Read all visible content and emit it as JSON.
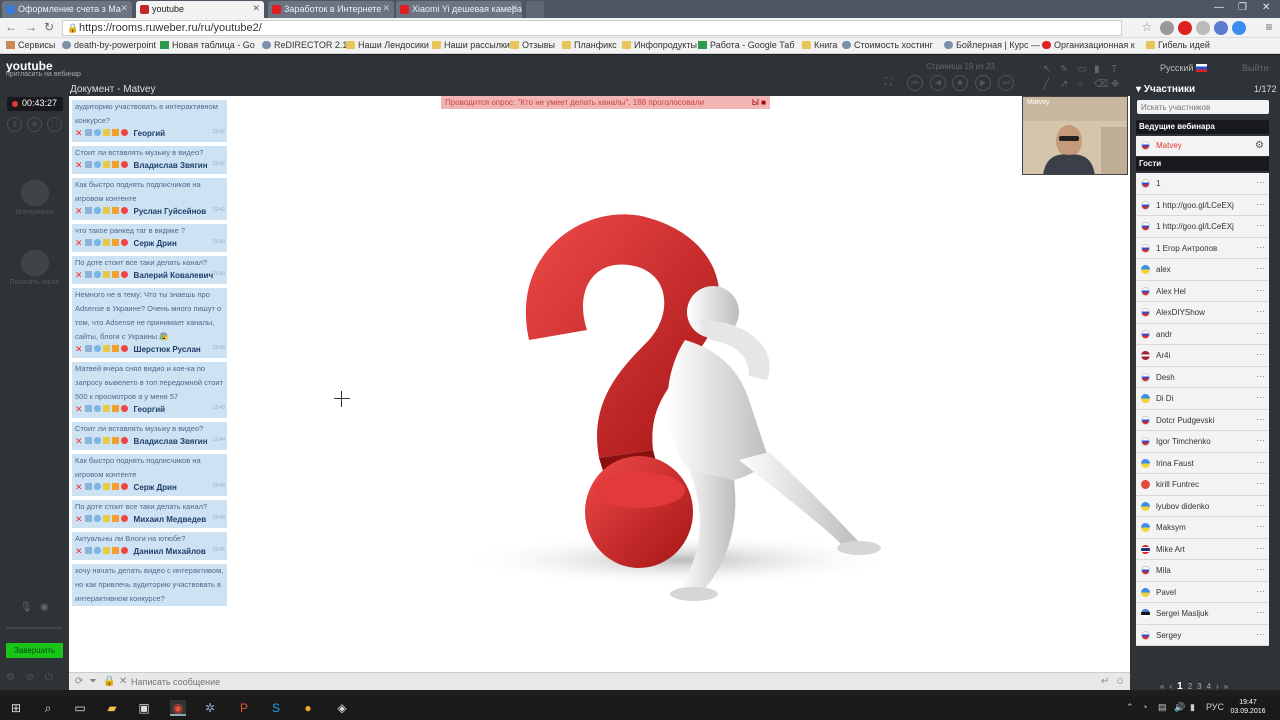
{
  "browser": {
    "tabs": [
      {
        "label": "Оформление счета з Ма",
        "active": false
      },
      {
        "label": "youtube",
        "active": true
      },
      {
        "label": "Заработок в Интернете",
        "active": false
      },
      {
        "label": "Xiaomi Yi дешевая камера",
        "active": false
      }
    ],
    "url": "https://rooms.ruweber.ru/ru/youtube2/",
    "bookmarks": [
      "Сервисы",
      "death-by-powerpoint",
      "Новая таблица - Go",
      "ReDIRECTOR 2.1.2",
      "Наши Лендосики",
      "Наши рассылки",
      "Отзывы",
      "Планфикс",
      "Инфопродукты",
      "Работа - Google Таб",
      "Книга",
      "Стоимость хостинг",
      "Бойлерная | Курс —",
      "Организационная к",
      "Гибель идей"
    ]
  },
  "app": {
    "title": "youtube",
    "subtitle": "пригласить на вебинар",
    "document_title": "Документ - Matvey",
    "page_indicator": "Страница 19 из 23",
    "language": "Русский",
    "exit_label": "Выйти",
    "timer": "00:43:27",
    "finish_label": "Завершить",
    "rail_items": [
      "Материалы",
      "Показать экран"
    ]
  },
  "poll_banner": {
    "text": "Проводится опрос: \"Кто не умеет делать каналы\", 188 проголосовали",
    "stop_label": "Ы ■"
  },
  "chat": {
    "placeholder": "Написать сообщение",
    "messages": [
      {
        "text": "аудиторию участвовать в интерактивном конкурсе?",
        "author": "Георгий",
        "time": "19:42"
      },
      {
        "text": "Стоит ли вставлять музыку в видео?",
        "author": "Владислав Звягин",
        "time": "19:42"
      },
      {
        "text": "Как быстро поднять подписчиков на игровом контенте",
        "author": "Руслан Гуйсейнов",
        "time": "19:42"
      },
      {
        "text": "что такое ранкед таг в видике ?",
        "author": "Серж Дрин",
        "time": "19:43"
      },
      {
        "text": "По доте стоит все таки делать канал?",
        "author": "Валерий Ковалевич",
        "time": "19:43"
      },
      {
        "text": "Немного не в тему: Что ты знаешь про Adsense в Украине? Очень много пишут о том, что Adsense не принимает каналы, сайты, блоги с Украины 😰",
        "author": "Шерстюк Руслан",
        "time": "19:43"
      },
      {
        "text": "Матвей вчера снял видио и кое-ка по запросу вывелето в топ передомной стоит 500 к просмотров а у меня 57",
        "author": "Георгий",
        "time": "19:43"
      },
      {
        "text": "Стоит ли вставлять музыку в видео?",
        "author": "Владислав Звягин",
        "time": "19:44"
      },
      {
        "text": "Как быстро поднять подписчиков на игровом контенте",
        "author": "Серж Дрин",
        "time": "19:44"
      },
      {
        "text": "По доте стоит все таки делать канал?",
        "author": "Михаил Медведев",
        "time": "19:44"
      },
      {
        "text": "Актуальны ли Влоги на ютюбе?",
        "author": "Даниил Михайлов",
        "time": "19:45"
      },
      {
        "text": "хочу начать делать видео с интерактивом, но как привлечь аудиторию участвовать в интерактивном конкурсе?",
        "author": "",
        "time": ""
      }
    ]
  },
  "sidebar": {
    "header": "Участники",
    "count": "1/172",
    "search_placeholder": "Искать участников",
    "hosts_label": "Ведущие вебинара",
    "host": "Matvey",
    "guests_label": "Гости",
    "camera_label": "Matvey",
    "participants": [
      {
        "name": "1",
        "flag": "ru"
      },
      {
        "name": "1 http://goo.gl/LCeEXj",
        "flag": "ru"
      },
      {
        "name": "1 http://goo.gl/LCeEXj",
        "flag": "ru"
      },
      {
        "name": "1 Егор Антропов",
        "flag": "ru"
      },
      {
        "name": "alex",
        "flag": "ua"
      },
      {
        "name": "Alex Hel",
        "flag": "ru"
      },
      {
        "name": "AlexDIYShow",
        "flag": "ru"
      },
      {
        "name": "andr",
        "flag": "ru"
      },
      {
        "name": "Ar4i",
        "flag": "lv"
      },
      {
        "name": "Desh",
        "flag": "ru"
      },
      {
        "name": "Di Di",
        "flag": "ua"
      },
      {
        "name": "Dotcr Pudgevski",
        "flag": "ru"
      },
      {
        "name": "Igor Timchenko",
        "flag": "ru"
      },
      {
        "name": "Irina Faust",
        "flag": "ua"
      },
      {
        "name": "kirill Funtrec",
        "flag": "by"
      },
      {
        "name": "lyubov didenko",
        "flag": "ua"
      },
      {
        "name": "Maksym",
        "flag": "ua"
      },
      {
        "name": "Mike Art",
        "flag": "th"
      },
      {
        "name": "Mila",
        "flag": "ru"
      },
      {
        "name": "Pavel",
        "flag": "ua"
      },
      {
        "name": "Sergei Masljuk",
        "flag": "ee"
      },
      {
        "name": "Sergey",
        "flag": "ru"
      }
    ],
    "pagination": [
      "«",
      "‹",
      "1",
      "2",
      "3",
      "4",
      "›",
      "»"
    ]
  },
  "taskbar": {
    "lang": "РУС",
    "time": "19:47",
    "date": "03.09.2016"
  },
  "colors": {
    "accent_red": "#e53935",
    "finish_green": "#19c519",
    "chat_bg": "#cde3f3",
    "dark_panel": "#2e3338"
  }
}
